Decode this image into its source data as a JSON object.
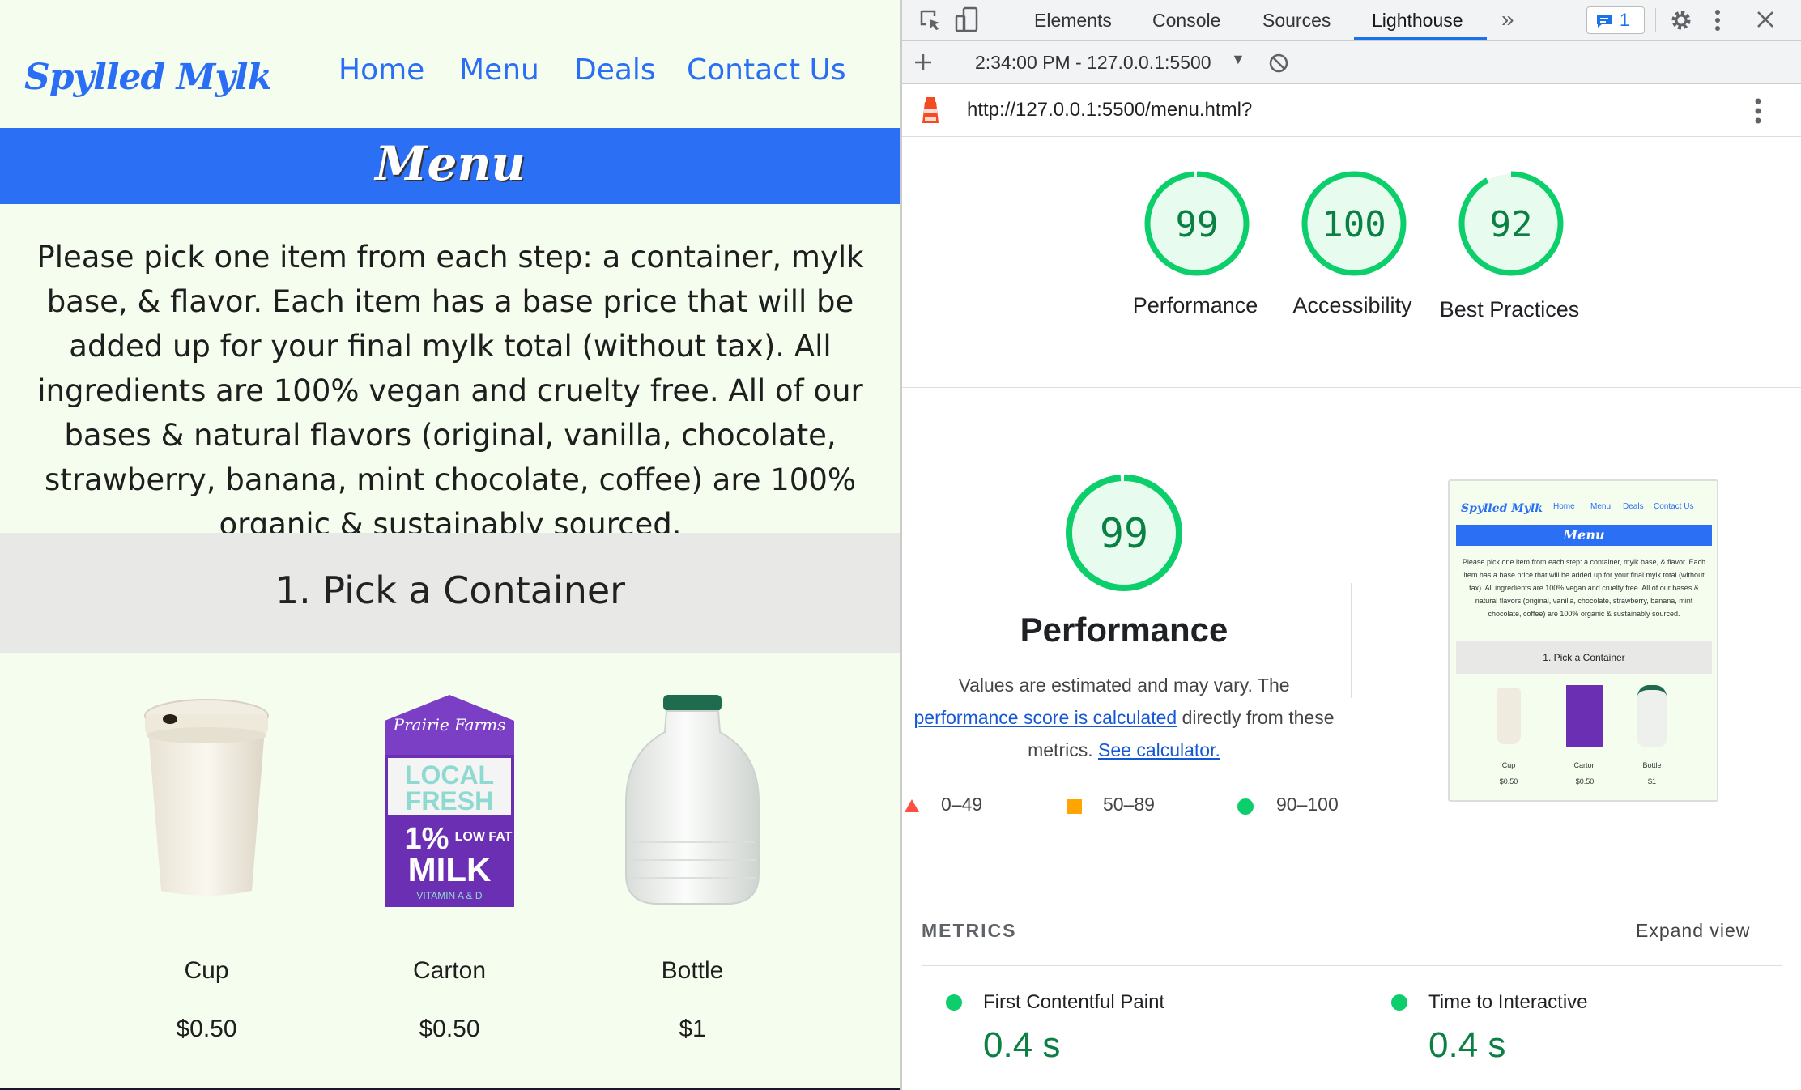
{
  "site": {
    "logo": "Spylled Mylk",
    "nav": [
      "Home",
      "Menu",
      "Deals",
      "Contact Us"
    ],
    "banner_title": "Menu",
    "intro": "Please pick one item from each step: a container, mylk base, & flavor. Each item has a base price that will be added up for your final mylk total (without tax). All ingredients are 100% vegan and cruelty free. All of our bases & natural flavors (original, vanilla, chocolate, strawberry, banana, mint chocolate, coffee) are 100% organic & sustainably sourced.",
    "step_title": "1. Pick a Container",
    "products": [
      {
        "name": "Cup",
        "price": "$0.50"
      },
      {
        "name": "Carton",
        "price": "$0.50"
      },
      {
        "name": "Bottle",
        "price": "$1"
      }
    ],
    "carton_texts": {
      "brand": "Prairie Farms",
      "line1": "LOCAL",
      "line2": "FRESH",
      "pct": "1%",
      "lowfat": "LOW FAT",
      "milk": "MILK",
      "vit": "VITAMIN A & D"
    }
  },
  "devtools": {
    "tabs": [
      "Elements",
      "Console",
      "Sources",
      "Lighthouse"
    ],
    "active_tab": "Lighthouse",
    "more_tabs": "»",
    "issues_count": "1",
    "report_time": "2:34:00 PM - 127.0.0.1:5500",
    "url": "http://127.0.0.1:5500/menu.html?",
    "scores": [
      {
        "label": "Performance",
        "value": "99"
      },
      {
        "label": "Accessibility",
        "value": "100"
      },
      {
        "label": "Best Practices",
        "value": "92"
      }
    ],
    "main_score": {
      "value": "99",
      "title": "Performance"
    },
    "desc_prefix": "Values are estimated and may vary. The",
    "desc_link": "performance score is calculated",
    "desc_mid": "directly from these metrics.",
    "desc_link2": "See calculator.",
    "legend": [
      "0–49",
      "50–89",
      "90–100"
    ],
    "metrics_header": "METRICS",
    "expand": "Expand view",
    "metrics": [
      {
        "name": "First Contentful Paint",
        "value": "0.4 s"
      },
      {
        "name": "Time to Interactive",
        "value": "0.4 s"
      }
    ],
    "colors": {
      "good": "#0cce6b",
      "average": "#ffa400",
      "fail": "#ff4e42",
      "accent": "#1a73e8"
    }
  }
}
